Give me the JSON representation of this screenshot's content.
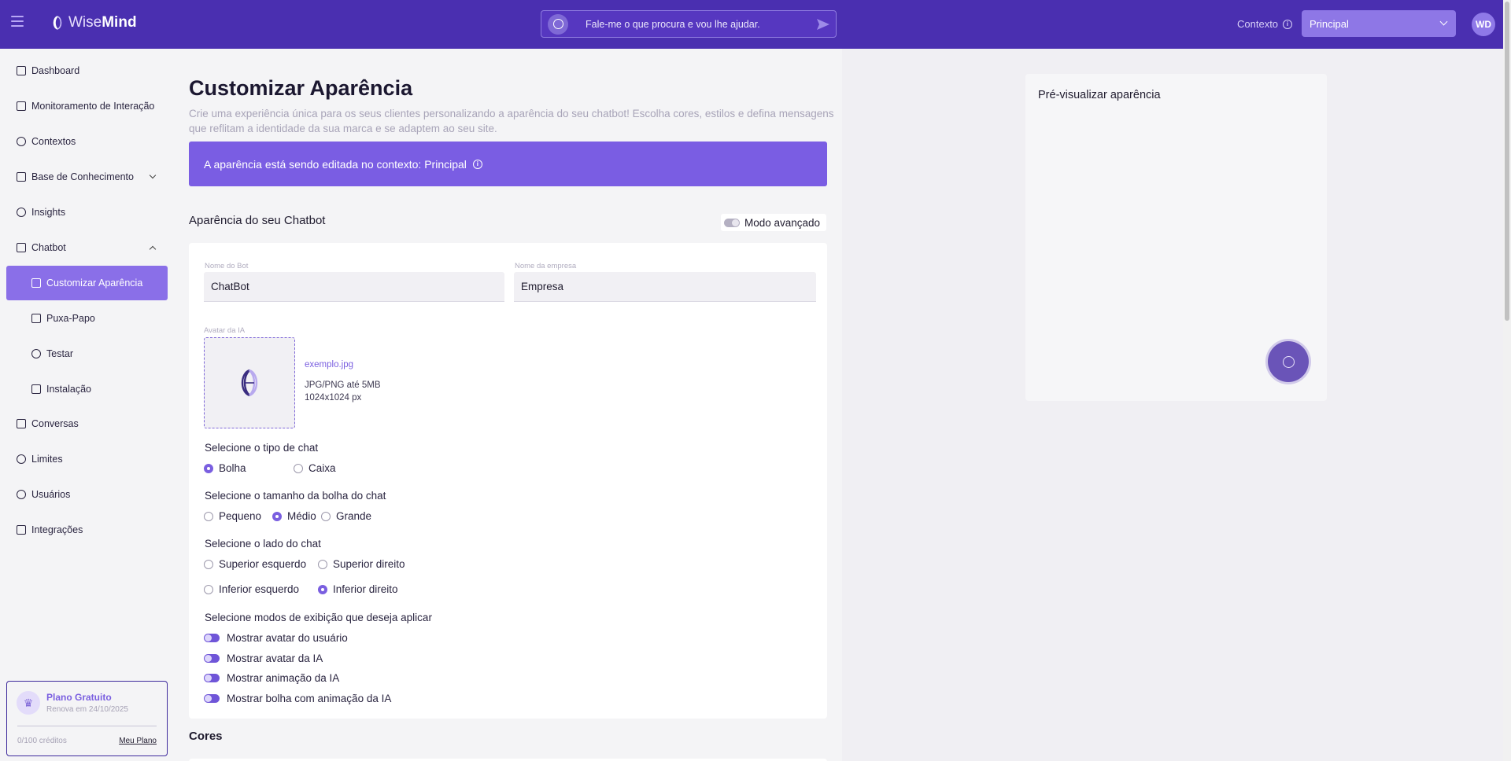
{
  "header": {
    "logo_word1": "Wise",
    "logo_word2": "Mind",
    "search_placeholder": "Fale-me o que procura e vou lhe ajudar.",
    "context_label": "Contexto",
    "context_value": "Principal",
    "user_initials": "WD"
  },
  "sidebar": {
    "items": [
      {
        "label": "Dashboard"
      },
      {
        "label": "Monitoramento de Interação"
      },
      {
        "label": "Contextos"
      },
      {
        "label": "Base de Conhecimento"
      },
      {
        "label": "Insights"
      },
      {
        "label": "Chatbot"
      },
      {
        "label": "Customizar Aparência"
      },
      {
        "label": "Puxa-Papo"
      },
      {
        "label": "Testar"
      },
      {
        "label": "Instalação"
      },
      {
        "label": "Conversas"
      },
      {
        "label": "Limites"
      },
      {
        "label": "Usuários"
      },
      {
        "label": "Integrações"
      }
    ],
    "plan": {
      "title": "Plano Gratuito",
      "renew": "Renova em 24/10/2025",
      "credits": "0/100 créditos",
      "link": "Meu Plano"
    }
  },
  "main": {
    "title": "Customizar Aparência",
    "description": "Crie uma experiência única para os seus clientes personalizando a aparência do seu chatbot! Escolha cores, estilos e defina mensagens que reflitam a identidade da sua marca e se adaptem ao seu site.",
    "banner": "A aparência está sendo editada no contexto: Principal",
    "section_title": "Aparência do seu Chatbot",
    "advanced_mode": "Modo avançado",
    "bot_name_label": "Nome do Bot",
    "bot_name_value": "ChatBot",
    "company_label": "Nome da empresa",
    "company_value": "Empresa",
    "avatar_label": "Avatar da IA",
    "avatar_file": "exemplo.jpg",
    "avatar_format": "JPG/PNG até 5MB",
    "avatar_size": "1024x1024 px",
    "chat_type": {
      "label": "Selecione o tipo de chat",
      "options": [
        "Bolha",
        "Caixa"
      ],
      "selected": "Bolha"
    },
    "bubble_size": {
      "label": "Selecione o tamanho da bolha do chat",
      "options": [
        "Pequeno",
        "Médio",
        "Grande"
      ],
      "selected": "Médio"
    },
    "chat_side": {
      "label": "Selecione o lado do chat",
      "options": [
        "Superior esquerdo",
        "Superior direito",
        "Inferior esquerdo",
        "Inferior direito"
      ],
      "selected": "Inferior direito"
    },
    "display_modes": {
      "label": "Selecione modos de exibição que deseja aplicar",
      "options": [
        "Mostrar avatar do usuário",
        "Mostrar avatar da IA",
        "Mostrar animação da IA",
        "Mostrar bolha com animação da IA"
      ]
    },
    "colors_title": "Cores"
  },
  "preview": {
    "title": "Pré-visualizar aparência"
  },
  "colors": {
    "topbar": "#4a2fb0",
    "accent": "#7a5de3",
    "active_nav": "#8a6fe8"
  }
}
